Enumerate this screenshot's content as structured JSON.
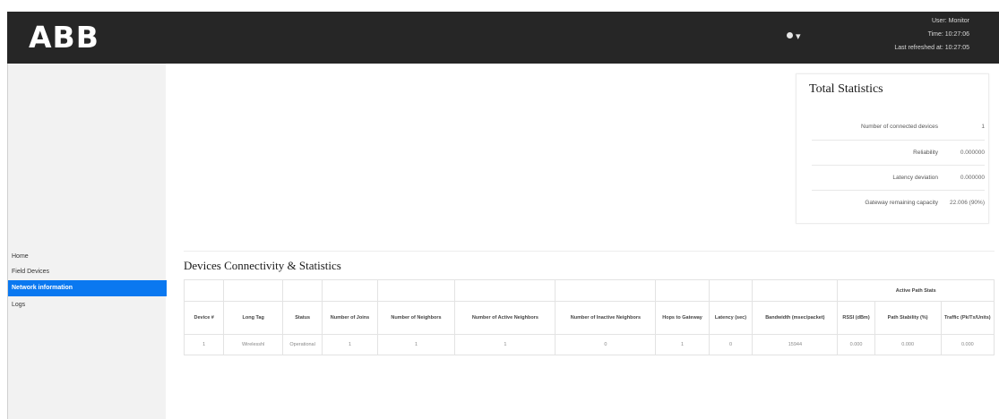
{
  "header": {
    "logo": "ABB",
    "user_menu": "▾",
    "user_line": "User: Monitor",
    "time_line": "Time: 10:27:06",
    "refreshed_line": "Last refreshed at: 10:27:05"
  },
  "nav": [
    {
      "label": "Home",
      "active": false
    },
    {
      "label": "Field Devices",
      "active": false
    },
    {
      "label": "Network information",
      "active": true
    },
    {
      "label": "Logs",
      "active": false
    }
  ],
  "total_stats": {
    "title": "Total Statistics",
    "rows": [
      {
        "label": "Number of connected devices",
        "value": "1"
      },
      {
        "label": "Reliability",
        "value": "0.000000"
      },
      {
        "label": "Latency deviation",
        "value": "0.000000"
      },
      {
        "label": "Gateway remaining capacity",
        "value": "22.006 (90%)"
      }
    ]
  },
  "connectivity": {
    "title": "Devices Connectivity & Statistics",
    "group_header": "Active Path Stats",
    "columns": [
      "Device #",
      "Long Tag",
      "Status",
      "Number of Joins",
      "Number of Neighbors",
      "Number of Active Neighbors",
      "Number of Inactive Neighbors",
      "Hops to Gateway",
      "Latency (sec)",
      "Bandwidth (msec/packet)",
      "RSSI (dBm)",
      "Path Stability (%)",
      "Traffic (Pk/Tx/Units)"
    ],
    "rows": [
      [
        "1",
        "Wirelesshl",
        "Operational",
        "1",
        "1",
        "1",
        "0",
        "1",
        "0",
        "15944",
        "0.000",
        "0.000",
        "0.000"
      ]
    ]
  }
}
